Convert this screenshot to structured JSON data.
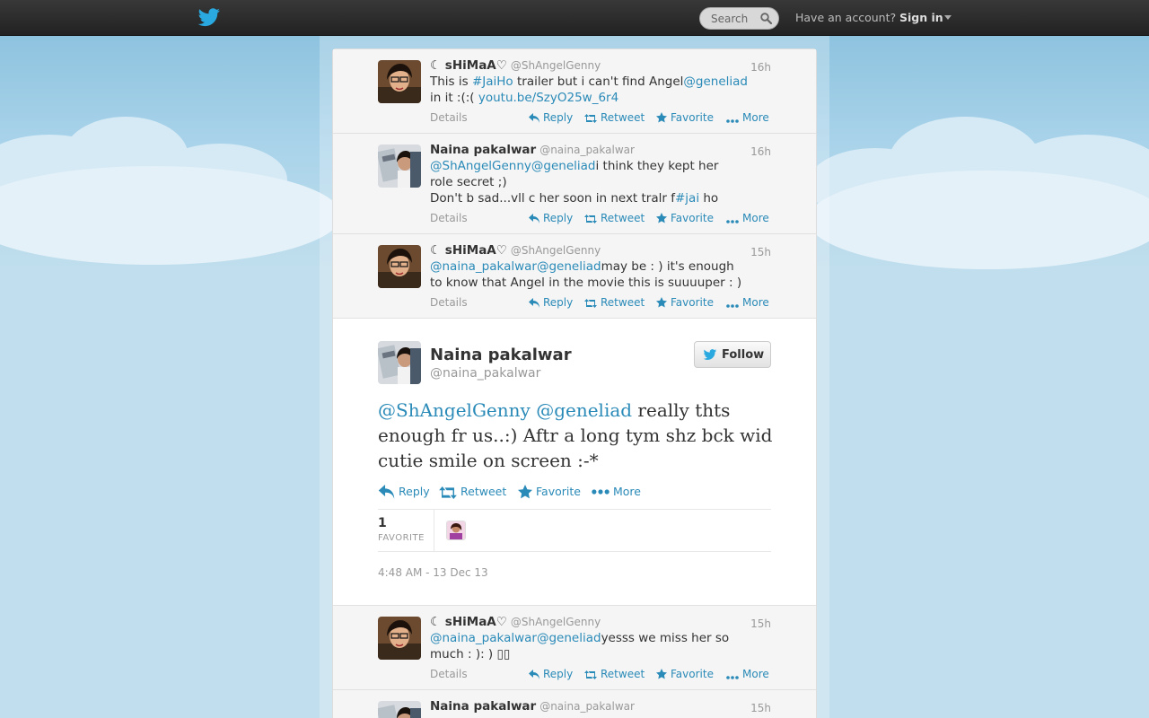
{
  "header": {
    "search_placeholder": "Search",
    "have_account": "Have an account?",
    "sign_in": "Sign in"
  },
  "colors": {
    "link": "#2a8ab8",
    "topbar": "#2b2b2b",
    "sky": "#c0deed"
  },
  "tweets_before": [
    {
      "name": "☾ sHiMaA♡",
      "handle": "@ShAngelGenny",
      "time": "16h",
      "line1_a": "This is ",
      "line1_link1": "#JaiHo",
      "line1_b": " trailer but i can't find Angel",
      "line1_link2": "@geneliad",
      "line2_a": "in it :(:( ",
      "line2_link": "youtu.be/SzyO25w_6r4"
    },
    {
      "name": "Naina pakalwar",
      "handle": "@naina_pakalwar",
      "time": "16h",
      "line1_link1": "@ShAngelGenny",
      "line1_link2": "@geneliad",
      "line1_b": "i think they kept her",
      "line2": "role secret ;)",
      "line3_a": "Don't b sad...vll c her soon in next tralr f",
      "line3_link": "#jai",
      "line3_b": " ho"
    },
    {
      "name": "☾ sHiMaA♡",
      "handle": "@ShAngelGenny",
      "time": "15h",
      "line1_link1": "@naina_pakalwar",
      "line1_link2": "@geneliad",
      "line1_b": "may be : ) it's enough",
      "line2": "to know that Angel in the movie this is suuuuper : )"
    }
  ],
  "actions": {
    "details": "Details",
    "reply": "Reply",
    "retweet": "Retweet",
    "favorite": "Favorite",
    "more": "More"
  },
  "main_tweet": {
    "name": "Naina pakalwar",
    "handle": "@naina_pakalwar",
    "follow_label": "Follow",
    "link1": "@ShAngelGenny",
    "link2": "@geneliad",
    "text_a": " really thts enough fr us..:) Aftr a long tym shz bck wid cutie smile on screen :-*",
    "favorite_count": "1",
    "favorite_label": "FAVORITE",
    "timestamp": "4:48 AM - 13 Dec 13"
  },
  "tweets_after": [
    {
      "name": "☾ sHiMaA♡",
      "handle": "@ShAngelGenny",
      "time": "15h",
      "line1_link1": "@naina_pakalwar",
      "line1_link2": "@geneliad",
      "line1_b": "yesss we miss her so",
      "line2": "much : ): ) ▯▯"
    },
    {
      "name": "Naina pakalwar",
      "handle": "@naina_pakalwar",
      "time": "15h"
    }
  ]
}
